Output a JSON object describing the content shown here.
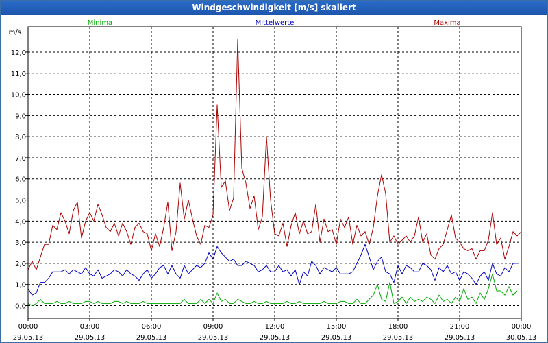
{
  "window": {
    "title": "Windgeschwindigkeit [m/s] skaliert"
  },
  "chart_data": {
    "type": "line",
    "title": "Windgeschwindigkeit [m/s] skaliert",
    "ylabel": "m/s",
    "xlabel": "",
    "ylim": [
      -0.6,
      13.2
    ],
    "xlim": [
      0,
      24
    ],
    "y_ticks": [
      "0,0",
      "1,0",
      "2,0",
      "3,0",
      "4,0",
      "5,0",
      "6,0",
      "7,0",
      "8,0",
      "9,0",
      "10,0",
      "11,0",
      "12,0"
    ],
    "x_ticks": [
      {
        "time": "00:00",
        "date": "29.05.13"
      },
      {
        "time": "03:00",
        "date": "29.05.13"
      },
      {
        "time": "06:00",
        "date": "29.05.13"
      },
      {
        "time": "09:00",
        "date": "29.05.13"
      },
      {
        "time": "12:00",
        "date": "29.05.13"
      },
      {
        "time": "15:00",
        "date": "29.05.13"
      },
      {
        "time": "18:00",
        "date": "29.05.13"
      },
      {
        "time": "21:00",
        "date": "29.05.13"
      },
      {
        "time": "00:00",
        "date": "30.05.13"
      }
    ],
    "grid": true,
    "legend_position": "top",
    "series": [
      {
        "name": "Minima",
        "color": "#00aa00",
        "x": [
          0,
          0.2,
          0.4,
          0.6,
          0.8,
          1.0,
          1.2,
          1.4,
          1.6,
          1.8,
          2.0,
          2.2,
          2.4,
          2.6,
          2.8,
          3.0,
          3.2,
          3.4,
          3.6,
          3.8,
          4.0,
          4.2,
          4.4,
          4.6,
          4.8,
          5.0,
          5.2,
          5.4,
          5.6,
          5.8,
          6.0,
          6.2,
          6.4,
          6.6,
          6.8,
          7.0,
          7.2,
          7.4,
          7.6,
          7.8,
          8.0,
          8.2,
          8.4,
          8.6,
          8.8,
          9.0,
          9.2,
          9.4,
          9.6,
          9.8,
          10.0,
          10.2,
          10.4,
          10.6,
          10.8,
          11.0,
          11.2,
          11.4,
          11.6,
          11.8,
          12.0,
          12.2,
          12.4,
          12.6,
          12.8,
          13.0,
          13.2,
          13.4,
          13.6,
          13.8,
          14.0,
          14.2,
          14.4,
          14.6,
          14.8,
          15.0,
          15.2,
          15.4,
          15.6,
          15.8,
          16.0,
          16.2,
          16.4,
          16.6,
          16.8,
          17.0,
          17.2,
          17.4,
          17.6,
          17.8,
          18.0,
          18.2,
          18.4,
          18.6,
          18.8,
          19.0,
          19.2,
          19.4,
          19.6,
          19.8,
          20.0,
          20.2,
          20.4,
          20.6,
          20.8,
          21.0,
          21.2,
          21.4,
          21.6,
          21.8,
          22.0,
          22.2,
          22.4,
          22.6,
          22.8,
          23.0,
          23.2,
          23.4,
          23.6,
          23.8
        ],
        "values": [
          0.1,
          0.0,
          0.1,
          0.3,
          0.1,
          0.1,
          0.1,
          0.2,
          0.1,
          0.1,
          0.2,
          0.1,
          0.1,
          0.1,
          0.2,
          0.2,
          0.1,
          0.2,
          0.1,
          0.1,
          0.1,
          0.2,
          0.2,
          0.1,
          0.2,
          0.1,
          0.1,
          0.1,
          0.2,
          0.1,
          0.1,
          0.1,
          0.1,
          0.1,
          0.1,
          0.1,
          0.1,
          0.1,
          0.3,
          0.1,
          0.1,
          0.1,
          0.3,
          0.1,
          0.3,
          0.1,
          0.6,
          0.2,
          0.3,
          0.1,
          0.1,
          0.3,
          0.2,
          0.1,
          0.1,
          0.2,
          0.1,
          0.1,
          0.2,
          0.1,
          0.1,
          0.1,
          0.1,
          0.2,
          0.1,
          0.1,
          0.2,
          0.1,
          0.1,
          0.1,
          0.1,
          0.1,
          0.2,
          0.1,
          0.1,
          0.1,
          0.2,
          0.2,
          0.1,
          0.1,
          0.3,
          0.1,
          0.1,
          0.3,
          0.5,
          1.0,
          0.3,
          0.2,
          1.1,
          0.1,
          0.2,
          0.4,
          0.1,
          0.4,
          0.2,
          0.3,
          0.2,
          0.4,
          0.3,
          0.1,
          0.5,
          0.2,
          0.3,
          0.1,
          0.4,
          0.2,
          0.8,
          0.3,
          0.4,
          0.1,
          0.6,
          0.3,
          0.8,
          1.5,
          0.7,
          0.7,
          0.5,
          0.9,
          0.5,
          0.7
        ]
      },
      {
        "name": "Mittelwerte",
        "color": "#0000c0",
        "x": [
          0,
          0.2,
          0.4,
          0.6,
          0.8,
          1.0,
          1.2,
          1.4,
          1.6,
          1.8,
          2.0,
          2.2,
          2.4,
          2.6,
          2.8,
          3.0,
          3.2,
          3.4,
          3.6,
          3.8,
          4.0,
          4.2,
          4.4,
          4.6,
          4.8,
          5.0,
          5.2,
          5.4,
          5.6,
          5.8,
          6.0,
          6.2,
          6.4,
          6.6,
          6.8,
          7.0,
          7.2,
          7.4,
          7.6,
          7.8,
          8.0,
          8.2,
          8.4,
          8.6,
          8.8,
          9.0,
          9.2,
          9.4,
          9.6,
          9.8,
          10.0,
          10.2,
          10.4,
          10.6,
          10.8,
          11.0,
          11.2,
          11.4,
          11.6,
          11.8,
          12.0,
          12.2,
          12.4,
          12.6,
          12.8,
          13.0,
          13.2,
          13.4,
          13.6,
          13.8,
          14.0,
          14.2,
          14.4,
          14.6,
          14.8,
          15.0,
          15.2,
          15.4,
          15.6,
          15.8,
          16.0,
          16.2,
          16.4,
          16.6,
          16.8,
          17.0,
          17.2,
          17.4,
          17.6,
          17.8,
          18.0,
          18.2,
          18.4,
          18.6,
          18.8,
          19.0,
          19.2,
          19.4,
          19.6,
          19.8,
          20.0,
          20.2,
          20.4,
          20.6,
          20.8,
          21.0,
          21.2,
          21.4,
          21.6,
          21.8,
          22.0,
          22.2,
          22.4,
          22.6,
          22.8,
          23.0,
          23.2,
          23.4,
          23.6,
          23.8
        ],
        "values": [
          0.8,
          0.5,
          0.6,
          1.1,
          1.1,
          1.3,
          1.6,
          1.6,
          1.6,
          1.7,
          1.5,
          1.7,
          1.6,
          1.5,
          1.8,
          1.5,
          1.4,
          1.7,
          1.3,
          1.4,
          1.5,
          1.7,
          1.6,
          1.4,
          1.7,
          1.5,
          1.4,
          1.2,
          1.5,
          1.7,
          1.3,
          1.5,
          1.8,
          1.9,
          1.5,
          1.9,
          1.5,
          1.3,
          1.9,
          1.5,
          1.7,
          1.9,
          1.8,
          2.0,
          2.5,
          2.2,
          2.8,
          2.5,
          2.3,
          2.1,
          2.2,
          1.9,
          1.9,
          2.1,
          2.0,
          1.9,
          1.6,
          1.7,
          1.9,
          1.6,
          1.6,
          1.9,
          1.6,
          1.7,
          1.4,
          1.7,
          1.0,
          1.6,
          1.4,
          2.1,
          1.9,
          1.5,
          1.8,
          1.7,
          1.6,
          1.8,
          1.5,
          1.5,
          1.5,
          1.6,
          2.0,
          2.4,
          2.9,
          2.3,
          1.7,
          2.1,
          2.3,
          1.6,
          1.5,
          1.1,
          1.9,
          1.5,
          1.9,
          1.8,
          1.6,
          1.6,
          2.0,
          1.9,
          1.7,
          1.2,
          1.8,
          1.6,
          1.9,
          1.5,
          1.6,
          1.2,
          1.6,
          1.5,
          1.3,
          1.0,
          1.4,
          1.6,
          1.2,
          2.0,
          1.5,
          1.4,
          1.8,
          1.6,
          2.0,
          2.0
        ]
      },
      {
        "name": "Maxima",
        "color": "#aa0000",
        "x": [
          0,
          0.2,
          0.4,
          0.6,
          0.8,
          1.0,
          1.2,
          1.4,
          1.6,
          1.8,
          2.0,
          2.2,
          2.4,
          2.6,
          2.8,
          3.0,
          3.2,
          3.4,
          3.6,
          3.8,
          4.0,
          4.2,
          4.4,
          4.6,
          4.8,
          5.0,
          5.2,
          5.4,
          5.6,
          5.8,
          6.0,
          6.2,
          6.4,
          6.6,
          6.8,
          7.0,
          7.2,
          7.4,
          7.6,
          7.8,
          8.0,
          8.2,
          8.4,
          8.6,
          8.8,
          9.0,
          9.2,
          9.4,
          9.6,
          9.8,
          10.0,
          10.2,
          10.4,
          10.6,
          10.8,
          11.0,
          11.2,
          11.4,
          11.6,
          11.8,
          12.0,
          12.2,
          12.4,
          12.6,
          12.8,
          13.0,
          13.2,
          13.4,
          13.6,
          13.8,
          14.0,
          14.2,
          14.4,
          14.6,
          14.8,
          15.0,
          15.2,
          15.4,
          15.6,
          15.8,
          16.0,
          16.2,
          16.4,
          16.6,
          16.8,
          17.0,
          17.2,
          17.4,
          17.6,
          17.8,
          18.0,
          18.2,
          18.4,
          18.6,
          18.8,
          19.0,
          19.2,
          19.4,
          19.6,
          19.8,
          20.0,
          20.2,
          20.4,
          20.6,
          20.8,
          21.0,
          21.2,
          21.4,
          21.6,
          21.8,
          22.0,
          22.2,
          22.4,
          22.6,
          22.8,
          23.0,
          23.2,
          23.4,
          23.6,
          23.8,
          24.0
        ],
        "values": [
          1.7,
          2.1,
          1.7,
          2.3,
          2.9,
          2.9,
          3.8,
          3.6,
          4.4,
          4.0,
          3.4,
          4.5,
          4.9,
          3.2,
          4.0,
          4.4,
          4.0,
          4.8,
          4.3,
          3.7,
          3.5,
          3.9,
          3.3,
          3.9,
          3.5,
          2.9,
          3.7,
          3.9,
          3.5,
          3.4,
          2.6,
          3.4,
          2.8,
          3.7,
          4.9,
          2.6,
          3.5,
          5.8,
          4.1,
          5.0,
          4.1,
          3.3,
          2.9,
          3.8,
          3.7,
          4.3,
          9.5,
          5.6,
          5.9,
          4.5,
          5.1,
          12.6,
          6.5,
          5.8,
          4.6,
          5.2,
          3.6,
          4.2,
          8.0,
          5.0,
          3.4,
          3.3,
          3.9,
          2.8,
          3.8,
          4.4,
          3.4,
          4.0,
          3.4,
          3.5,
          4.8,
          3.0,
          4.1,
          3.5,
          3.6,
          2.9,
          4.1,
          3.7,
          4.2,
          2.9,
          3.8,
          3.3,
          3.5,
          2.9,
          3.7,
          5.2,
          6.2,
          5.3,
          3.0,
          3.3,
          2.9,
          3.1,
          3.3,
          3.0,
          3.3,
          4.2,
          3.0,
          3.4,
          2.4,
          2.2,
          2.7,
          2.9,
          3.6,
          4.3,
          3.2,
          3.0,
          2.7,
          2.6,
          2.7,
          2.2,
          2.6,
          2.6,
          3.1,
          4.4,
          2.9,
          3.2,
          2.2,
          2.8,
          3.5,
          3.3,
          3.5
        ]
      }
    ]
  }
}
